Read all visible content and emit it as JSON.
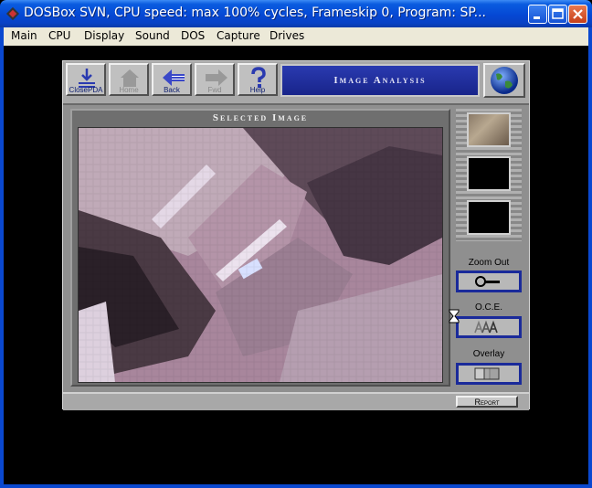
{
  "window": {
    "title": "DOSBox SVN, CPU speed: max 100% cycles, Frameskip  0, Program:    SP...",
    "icons": {
      "app": "dosbox-icon",
      "minimize": "minimize-icon",
      "maximize": "maximize-icon",
      "close": "close-icon"
    }
  },
  "menu": [
    "Main",
    "CPU",
    "Display",
    "Sound",
    "DOS",
    "Capture",
    "Drives"
  ],
  "toolbar": {
    "buttons": [
      {
        "label": "ClosePDA",
        "icon": "close-pda-icon",
        "enabled": true
      },
      {
        "label": "Home",
        "icon": "home-icon",
        "enabled": false
      },
      {
        "label": "Back",
        "icon": "back-arrow-icon",
        "enabled": true
      },
      {
        "label": "Fwd",
        "icon": "forward-arrow-icon",
        "enabled": false
      },
      {
        "label": "Help",
        "icon": "question-mark-icon",
        "enabled": true
      }
    ],
    "banner": "Image Analysis",
    "globe_icon": "globe-icon"
  },
  "panel": {
    "title": "Selected Image"
  },
  "side": {
    "zoom_out_label": "Zoom Out",
    "oce_label": "O.C.E.",
    "overlay_label": "Overlay",
    "zoom_icon": "magnifier-icon",
    "oce_icon": "aaa-icon",
    "overlay_icon": "overlay-icon"
  },
  "status": {
    "report_label": "Report"
  },
  "colors": {
    "title_bar": "#0548d4",
    "menu_bg": "#ece9d8",
    "banner_bg": "#2a3ab0",
    "button_border": "#1a2a9a"
  }
}
